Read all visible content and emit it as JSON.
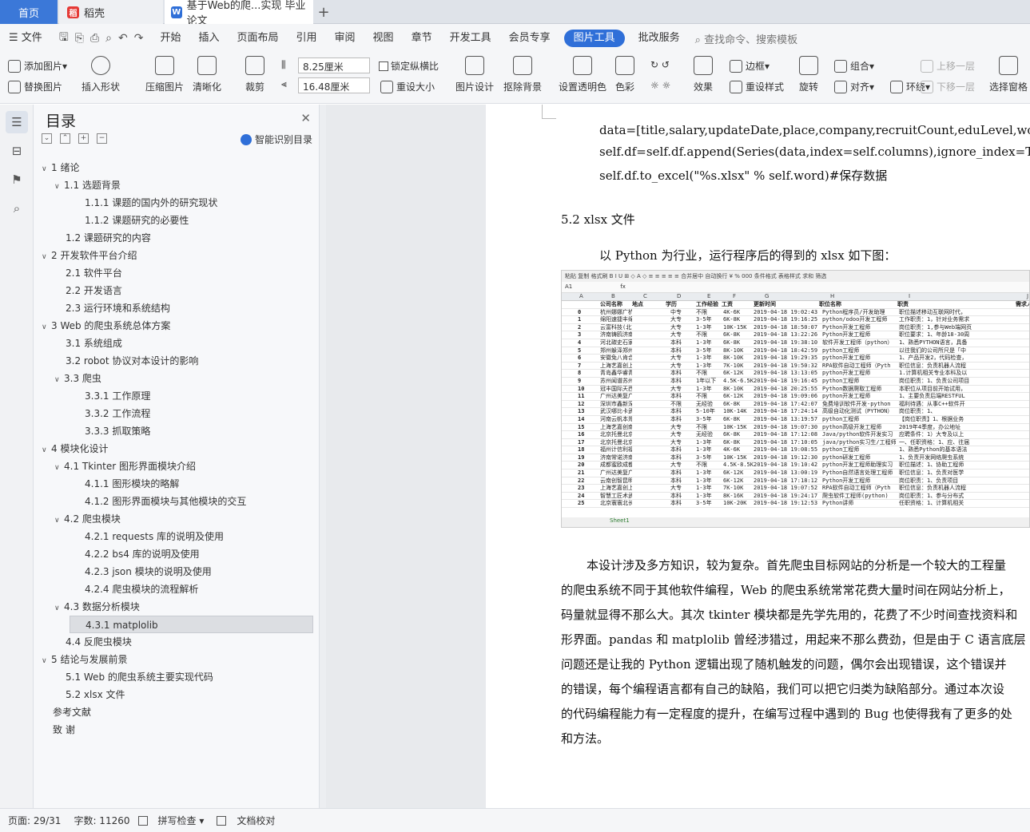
{
  "tabs": {
    "home": "首页",
    "doc1": "稻壳",
    "doc2": "基于Web的爬...实现 毕业论文",
    "add": "+"
  },
  "menu": {
    "file": "文件",
    "items": [
      "开始",
      "插入",
      "页面布局",
      "引用",
      "审阅",
      "视图",
      "章节",
      "开发工具",
      "会员专享",
      "图片工具",
      "批改服务"
    ],
    "active_index": 9,
    "search": "查找命令、搜索模板"
  },
  "ribbon": {
    "add_image": "添加图片",
    "replace_image": "替换图片",
    "insert_shape": "插入形状",
    "compress": "压缩图片",
    "sharpen": "清晰化",
    "crop": "裁剪",
    "width": "8.25厘米",
    "height": "16.48厘米",
    "lock_ratio": "锁定纵横比",
    "reset_size": "重设大小",
    "image_design": "图片设计",
    "remove_bg": "抠除背景",
    "set_transparent": "设置透明色",
    "color": "色彩",
    "effects": "效果",
    "border": "边框",
    "reset_style": "重设样式",
    "rotate": "旋转",
    "group": "组合",
    "align": "对齐",
    "wrap": "环绕",
    "bring_forward": "上移一层",
    "send_backward": "下移一层",
    "selection_pane": "选择窗格"
  },
  "toc": {
    "title": "目录",
    "smart": "智能识别目录",
    "items": [
      {
        "t": "1  绪论",
        "lv": 0,
        "arr": "v"
      },
      {
        "t": "1.1   选题背景",
        "lv": 1,
        "arr": "v"
      },
      {
        "t": "1.1.1  课题的国内外的研究现状",
        "lv": 2,
        "arr": ""
      },
      {
        "t": "1.1.2  课题研究的必要性",
        "lv": 2,
        "arr": ""
      },
      {
        "t": "1.2   课题研究的内容",
        "lv": 1,
        "arr": ""
      },
      {
        "t": "2  开发软件平台介绍",
        "lv": 0,
        "arr": "v"
      },
      {
        "t": "2.1  软件平台",
        "lv": 1,
        "arr": ""
      },
      {
        "t": "2.2  开发语言",
        "lv": 1,
        "arr": ""
      },
      {
        "t": "2.3  运行环境和系统结构",
        "lv": 1,
        "arr": ""
      },
      {
        "t": "3  Web 的爬虫系统总体方案",
        "lv": 0,
        "arr": "v"
      },
      {
        "t": "3.1   系统组成",
        "lv": 1,
        "arr": ""
      },
      {
        "t": "3.2   robot 协议对本设计的影响",
        "lv": 1,
        "arr": ""
      },
      {
        "t": "3.3   爬虫",
        "lv": 1,
        "arr": "v"
      },
      {
        "t": "3.3.1  工作原理",
        "lv": 2,
        "arr": ""
      },
      {
        "t": "3.3.2  工作流程",
        "lv": 2,
        "arr": ""
      },
      {
        "t": "3.3.3  抓取策略",
        "lv": 2,
        "arr": ""
      },
      {
        "t": "4  模块化设计",
        "lv": 0,
        "arr": "v"
      },
      {
        "t": "4.1  Tkinter 图形界面模块介绍",
        "lv": 1,
        "arr": "v"
      },
      {
        "t": "4.1.1  图形模块的略解",
        "lv": 2,
        "arr": ""
      },
      {
        "t": "4.1.2  图形界面模块与其他模块的交互",
        "lv": 2,
        "arr": ""
      },
      {
        "t": "4.2    爬虫模块",
        "lv": 1,
        "arr": "v"
      },
      {
        "t": "4.2.1  requests 库的说明及使用",
        "lv": 2,
        "arr": ""
      },
      {
        "t": "4.2.2  bs4 库的说明及使用",
        "lv": 2,
        "arr": ""
      },
      {
        "t": "4.2.3  json 模块的说明及使用",
        "lv": 2,
        "arr": ""
      },
      {
        "t": "4.2.4  爬虫模块的流程解析",
        "lv": 2,
        "arr": ""
      },
      {
        "t": "4.3 数据分析模块",
        "lv": 1,
        "arr": "v"
      },
      {
        "t": "4.3.1  matplolib",
        "lv": 2,
        "arr": "",
        "sel": true
      },
      {
        "t": "4.4    反爬虫模块",
        "lv": 1,
        "arr": ""
      },
      {
        "t": "5  结论与发展前景",
        "lv": 0,
        "arr": "v"
      },
      {
        "t": "5.1  Web 的爬虫系统主要实现代码",
        "lv": 1,
        "arr": ""
      },
      {
        "t": "5.2  xlsx 文件",
        "lv": 1,
        "arr": ""
      },
      {
        "t": "参考文献",
        "lv": 0,
        "arr": ""
      },
      {
        "t": "致    谢",
        "lv": 0,
        "arr": ""
      }
    ]
  },
  "doc": {
    "code1": "data=[title,salary,updateDate,place,company,recruitCount,eduLevel,workingExp,zhi",
    "code2": "self.df=self.df.append(Series(data,index=self.columns),ignore_index=True)",
    "code3": " self.df.to_excel(\"%s.xlsx\" % self.word)#保存数据",
    "heading": "5.2  xlsx 文件",
    "intro": "以 Python 为行业，运行程序后的得到的 xlsx 如下图：",
    "para": [
      "本设计涉及多方知识，较为复杂。首先爬虫目标网站的分析是一个较大的工程量",
      "的爬虫系统不同于其他软件编程，Web 的爬虫系统常常花费大量时间在网站分析上，",
      "码量就显得不那么大。其次 tkinter 模块都是先学先用的，花费了不少时间查找资料和",
      "形界面。pandas 和 matplolib 曾经涉猎过，用起来不那么费劲，但是由于 C 语言底层",
      "问题还是让我的 Python 逻辑出现了随机触发的问题，偶尔会出现错误，这个错误并",
      "的错误，每个编程语言都有自己的缺陷，我们可以把它归类为缺陷部分。通过本次设",
      "的代码编程能力有一定程度的提升，在编写过程中遇到的 Bug 也使得我有了更多的处",
      "和方法。"
    ]
  },
  "sheet": {
    "toolbar": "粘贴  复制  格式刷   B  I  U  ⊞  ◇  A  ◇    ≡  ≡  ≡  ≡  ≡   合并居中  自动换行   ¥  %  000   条件格式  表格样式   求和  筛选",
    "cell_ref": "A1",
    "fx": "fx",
    "cols": [
      "A",
      "B",
      "C",
      "D",
      "E",
      "F",
      "G",
      "H",
      "I",
      "J"
    ],
    "header": [
      "",
      "公司名称",
      "地点",
      "学历",
      "工作经验",
      "工资",
      "更新时间",
      "职位名称",
      "职责",
      "需求人"
    ],
    "rows": [
      [
        "0",
        "杭州娜娜广杭州",
        "中专",
        "不限",
        "4K-6K",
        "2019-04-18 19:02:43",
        "Python程序员/开发助理",
        "职位描述移动互联网时代，"
      ],
      [
        "1",
        "绵阳速捷丰绵阳",
        "大专",
        "3-5年",
        "6K-8K",
        "2019-04-18 19:16:25",
        "python/odoo开发工程师",
        "工作职责：1，针对业务需求"
      ],
      [
        "2",
        "云富科技(北京",
        "大专",
        "1-3年",
        "10K-15K",
        "2019-04-18 18:50:07",
        "Python开发工程师",
        "岗位职责：1,参与Web端网页"
      ],
      [
        "3",
        "济南铸鸥济南",
        "大专",
        "不限",
        "6K-8K",
        "2019-04-18 13:22:26",
        "Python开发工程师",
        "职位要求：1、年龄18-30周"
      ],
      [
        "4",
        "河北碳史石家庄",
        "本科",
        "1-3年",
        "6K-8K",
        "2019-04-18 19:38:10",
        "软件开发工程师（python）",
        "1、熟悉PYTHON语言，具备"
      ],
      [
        "5",
        "郑州躲泽郑州",
        "本科",
        "3-5年",
        "8K-10K",
        "2019-04-18 18:42:59",
        "python工程师",
        "以往我们的公司所尺是「中"
      ],
      [
        "6",
        "安徽免八肯合肥-蜀山",
        "大专",
        "1-3年",
        "8K-10K",
        "2019-04-18 19:29:35",
        "python开发工程师",
        "1、产品开发2，代码检查，"
      ],
      [
        "7",
        "上海艺嘉创上海",
        "大专",
        "1-3年",
        "7K-10K",
        "2019-04-18 19:50:32",
        "RPA软件自动工程师（Pyth",
        "职位信息：负责机器人流程"
      ],
      [
        "8",
        "青岛鑫华睿青岛",
        "本科",
        "不限",
        "6K-12K",
        "2019-04-18 13:13:05",
        "python开发工程师",
        "1.计算机相关专业本科及以"
      ],
      [
        "9",
        "苏州闻谱苏州-工业园",
        "本科",
        "1年以下",
        "4.5K-6.5K",
        "2019-04-18 19:16:45",
        "python工程师",
        "岗位职责：1、负责公司项目"
      ],
      [
        "10",
        "冠丰国际天西安",
        "大专",
        "1-3年",
        "8K-10K",
        "2019-04-18 20:25:55",
        "Python数据爬取工程师",
        "本职位从项目前开始试用，"
      ],
      [
        "11",
        "广州达美复广州",
        "本科",
        "不限",
        "6K-12K",
        "2019-04-18 19:09:06",
        "python开发工程师",
        "1、主要负责后端RESTFUL"
      ],
      [
        "12",
        "深圳市鑫新深圳",
        "不限",
        "无经验",
        "6K-8K",
        "2019-04-18 17:42:07",
        "免费培训软件开发-python",
        "福利待遇：从事C++软件开"
      ],
      [
        "13",
        "武汉哪比卡武汉",
        "本科",
        "5-10年",
        "10K-14K",
        "2019-04-18 17:24:14",
        "高级自动化测试（PYTHON）",
        "岗位职责：1、"
      ],
      [
        "14",
        "河南云帆本郑州-郑东",
        "本科",
        "3-5年",
        "6K-8K",
        "2019-04-18 13:19:57",
        "python工程师",
        "【岗位职责】1、根据业务"
      ],
      [
        "15",
        "上海艺嘉创南京",
        "大专",
        "不限",
        "10K-15K",
        "2019-04-18 19:07:30",
        "python高级开发工程师",
        "2019年4季度，办公地址"
      ],
      [
        "16",
        "北京托曼北京",
        "大专",
        "无经验",
        "6K-8K",
        "2019-04-18 17:12:08",
        "Java/python软件开发实习",
        "应聘条件：1）大专及以上"
      ],
      [
        "17",
        "北京托曼北京-昌平",
        "大专",
        "1-3年",
        "6K-8K",
        "2019-04-18 17:10:05",
        "java/python实习生/工程师",
        "一、任职资格：1、应、往届"
      ],
      [
        "18",
        "福州计信利福州",
        "本科",
        "1-3年",
        "4K-6K",
        "2019-04-18 19:08:55",
        "python工程师",
        "1、熟悉Python的基本语法"
      ],
      [
        "19",
        "济南常诺济南",
        "本科",
        "3-5年",
        "10K-15K",
        "2019-04-18 19:12:30",
        "python研发工程师",
        "1、负责开发网络爬虫系统"
      ],
      [
        "20",
        "成都蜜欧成都",
        "大专",
        "不限",
        "4.5K-8.5K",
        "2019-04-18 19:10:42",
        "python开发工程师助理实习",
        "职位描述：1、协助工程师"
      ],
      [
        "21",
        "广州达美复广州",
        "本科",
        "1-3年",
        "6K-12K",
        "2019-04-18 13:00:19",
        "Python自然语言处理工程师",
        "职位信息：1、负责对医学"
      ],
      [
        "22",
        "云南创智昆明",
        "本科",
        "1-3年",
        "6K-12K",
        "2019-04-18 17:18:12",
        "Python开发工程师",
        "岗位职责：1、负责项目"
      ],
      [
        "23",
        "上海艺嘉创上海",
        "大专",
        "1-3年",
        "7K-10K",
        "2019-04-18 19:07:52",
        "RPA软件自动工程师（Pyth",
        "职位信息：负责机器人流程"
      ],
      [
        "24",
        "智慧工匠术武汉",
        "本科",
        "1-3年",
        "8K-16K",
        "2019-04-18 19:24:17",
        "爬虫软件工程师(python)",
        "岗位职责：1、参与分布式"
      ],
      [
        "25",
        "北京寰寰北长沙",
        "本科",
        "3-5年",
        "10K-20K",
        "2019-04-18 19:12:53",
        "Python讲师",
        "任职资格：1、计算机相关"
      ]
    ],
    "tab": "Sheet1"
  },
  "status": {
    "page": "页面: 29/31",
    "words": "字数: 11260",
    "spell": "拼写检查",
    "proof": "文档校对"
  }
}
